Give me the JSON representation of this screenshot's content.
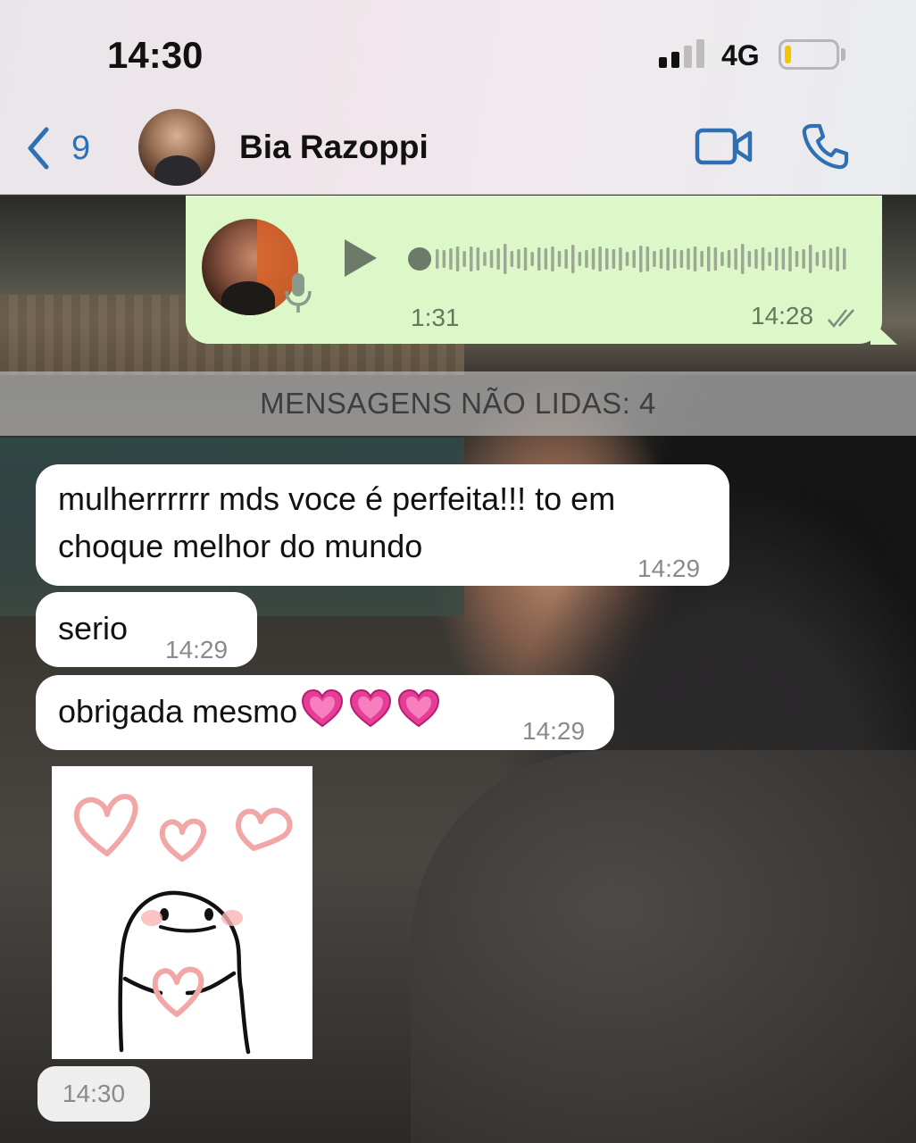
{
  "status_bar": {
    "time": "14:30",
    "network": "4G",
    "battery_level": 0.12,
    "signal_bars": 2
  },
  "header": {
    "back_count": "9",
    "contact_name": "Bia Razoppi",
    "accent_color": "#2f6fb3"
  },
  "voice_message": {
    "duration": "1:31",
    "time": "14:28",
    "bubble_color": "#dcf8c8",
    "icons": [
      "play-icon",
      "mic-icon",
      "double-check-icon"
    ]
  },
  "unread_divider": {
    "text": "MENSAGENS NÃO LIDAS: 4"
  },
  "messages": [
    {
      "text": "mulherrrrrr mds voce é perfeita!!! to em choque melhor do mundo",
      "time": "14:29"
    },
    {
      "text": "serio",
      "time": "14:29"
    },
    {
      "text": "obrigada mesmo",
      "emoji": "💗💗💗",
      "time": "14:29"
    }
  ],
  "sticker": {
    "time": "14:30"
  }
}
